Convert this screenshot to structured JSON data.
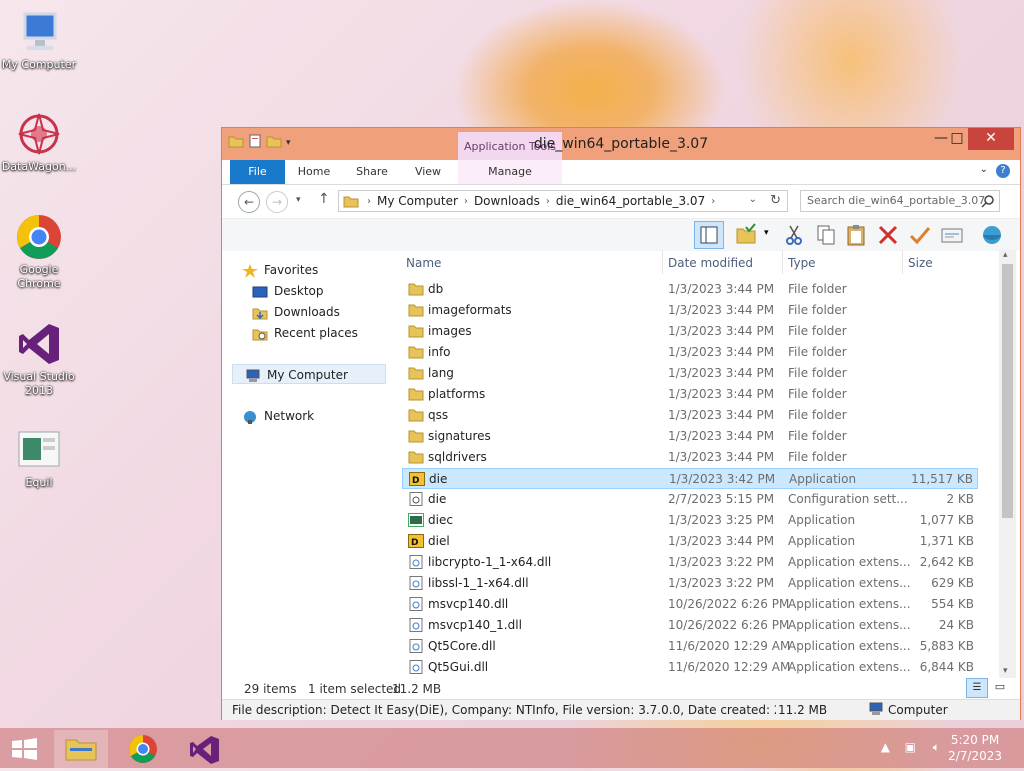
{
  "desktop": {
    "icons": [
      {
        "label": "My Computer"
      },
      {
        "label": "DataWagon..."
      },
      {
        "label": "Google Chrome"
      },
      {
        "label": "Visual Studio 2013"
      },
      {
        "label": "Equil"
      }
    ]
  },
  "window": {
    "title": "die_win64_portable_3.07",
    "context_tab": "Application Tools",
    "ribbon_tabs": {
      "file": "File",
      "home": "Home",
      "share": "Share",
      "view": "View",
      "manage": "Manage"
    },
    "address": {
      "crumbs": [
        "My Computer",
        "Downloads",
        "die_win64_portable_3.07"
      ]
    },
    "search_placeholder": "Search die_win64_portable_3.07",
    "nav": {
      "favorites": "Favorites",
      "desktop": "Desktop",
      "downloads": "Downloads",
      "recent": "Recent places",
      "mycomputer": "My Computer",
      "network": "Network"
    },
    "columns": {
      "name": "Name",
      "date": "Date modified",
      "type": "Type",
      "size": "Size"
    },
    "files": [
      {
        "name": "db",
        "date": "1/3/2023 3:44 PM",
        "type": "File folder",
        "size": "",
        "icon": "folder"
      },
      {
        "name": "imageformats",
        "date": "1/3/2023 3:44 PM",
        "type": "File folder",
        "size": "",
        "icon": "folder"
      },
      {
        "name": "images",
        "date": "1/3/2023 3:44 PM",
        "type": "File folder",
        "size": "",
        "icon": "folder"
      },
      {
        "name": "info",
        "date": "1/3/2023 3:44 PM",
        "type": "File folder",
        "size": "",
        "icon": "folder"
      },
      {
        "name": "lang",
        "date": "1/3/2023 3:44 PM",
        "type": "File folder",
        "size": "",
        "icon": "folder"
      },
      {
        "name": "platforms",
        "date": "1/3/2023 3:44 PM",
        "type": "File folder",
        "size": "",
        "icon": "folder"
      },
      {
        "name": "qss",
        "date": "1/3/2023 3:44 PM",
        "type": "File folder",
        "size": "",
        "icon": "folder"
      },
      {
        "name": "signatures",
        "date": "1/3/2023 3:44 PM",
        "type": "File folder",
        "size": "",
        "icon": "folder"
      },
      {
        "name": "sqldrivers",
        "date": "1/3/2023 3:44 PM",
        "type": "File folder",
        "size": "",
        "icon": "folder"
      },
      {
        "name": "die",
        "date": "1/3/2023 3:42 PM",
        "type": "Application",
        "size": "11,517 KB",
        "icon": "die-app",
        "selected": true
      },
      {
        "name": "die",
        "date": "2/7/2023 5:15 PM",
        "type": "Configuration sett...",
        "size": "2 KB",
        "icon": "config"
      },
      {
        "name": "diec",
        "date": "1/3/2023 3:25 PM",
        "type": "Application",
        "size": "1,077 KB",
        "icon": "console-app"
      },
      {
        "name": "diel",
        "date": "1/3/2023 3:44 PM",
        "type": "Application",
        "size": "1,371 KB",
        "icon": "die-app"
      },
      {
        "name": "libcrypto-1_1-x64.dll",
        "date": "1/3/2023 3:22 PM",
        "type": "Application extens...",
        "size": "2,642 KB",
        "icon": "dll"
      },
      {
        "name": "libssl-1_1-x64.dll",
        "date": "1/3/2023 3:22 PM",
        "type": "Application extens...",
        "size": "629 KB",
        "icon": "dll"
      },
      {
        "name": "msvcp140.dll",
        "date": "10/26/2022 6:26 PM",
        "type": "Application extens...",
        "size": "554 KB",
        "icon": "dll"
      },
      {
        "name": "msvcp140_1.dll",
        "date": "10/26/2022 6:26 PM",
        "type": "Application extens...",
        "size": "24 KB",
        "icon": "dll"
      },
      {
        "name": "Qt5Core.dll",
        "date": "11/6/2020 12:29 AM",
        "type": "Application extens...",
        "size": "5,883 KB",
        "icon": "dll"
      },
      {
        "name": "Qt5Gui.dll",
        "date": "11/6/2020 12:29 AM",
        "type": "Application extens...",
        "size": "6,844 KB",
        "icon": "dll"
      }
    ],
    "status": {
      "count": "29 items",
      "selection": "1 item selected",
      "sel_size": "11.2 MB"
    },
    "details": {
      "description": "File description: Detect It Easy(DiE), Company: NTInfo, File version: 3.7.0.0, Date created: 2/7/2023 5:14 P",
      "size": "11.2 MB",
      "location": "Computer"
    }
  },
  "taskbar": {
    "time": "5:20 PM",
    "date": "2/7/2023"
  },
  "colors": {
    "accent": "#1979ca",
    "titlebar": "#f0a07a",
    "selection": "#cce8ff"
  }
}
